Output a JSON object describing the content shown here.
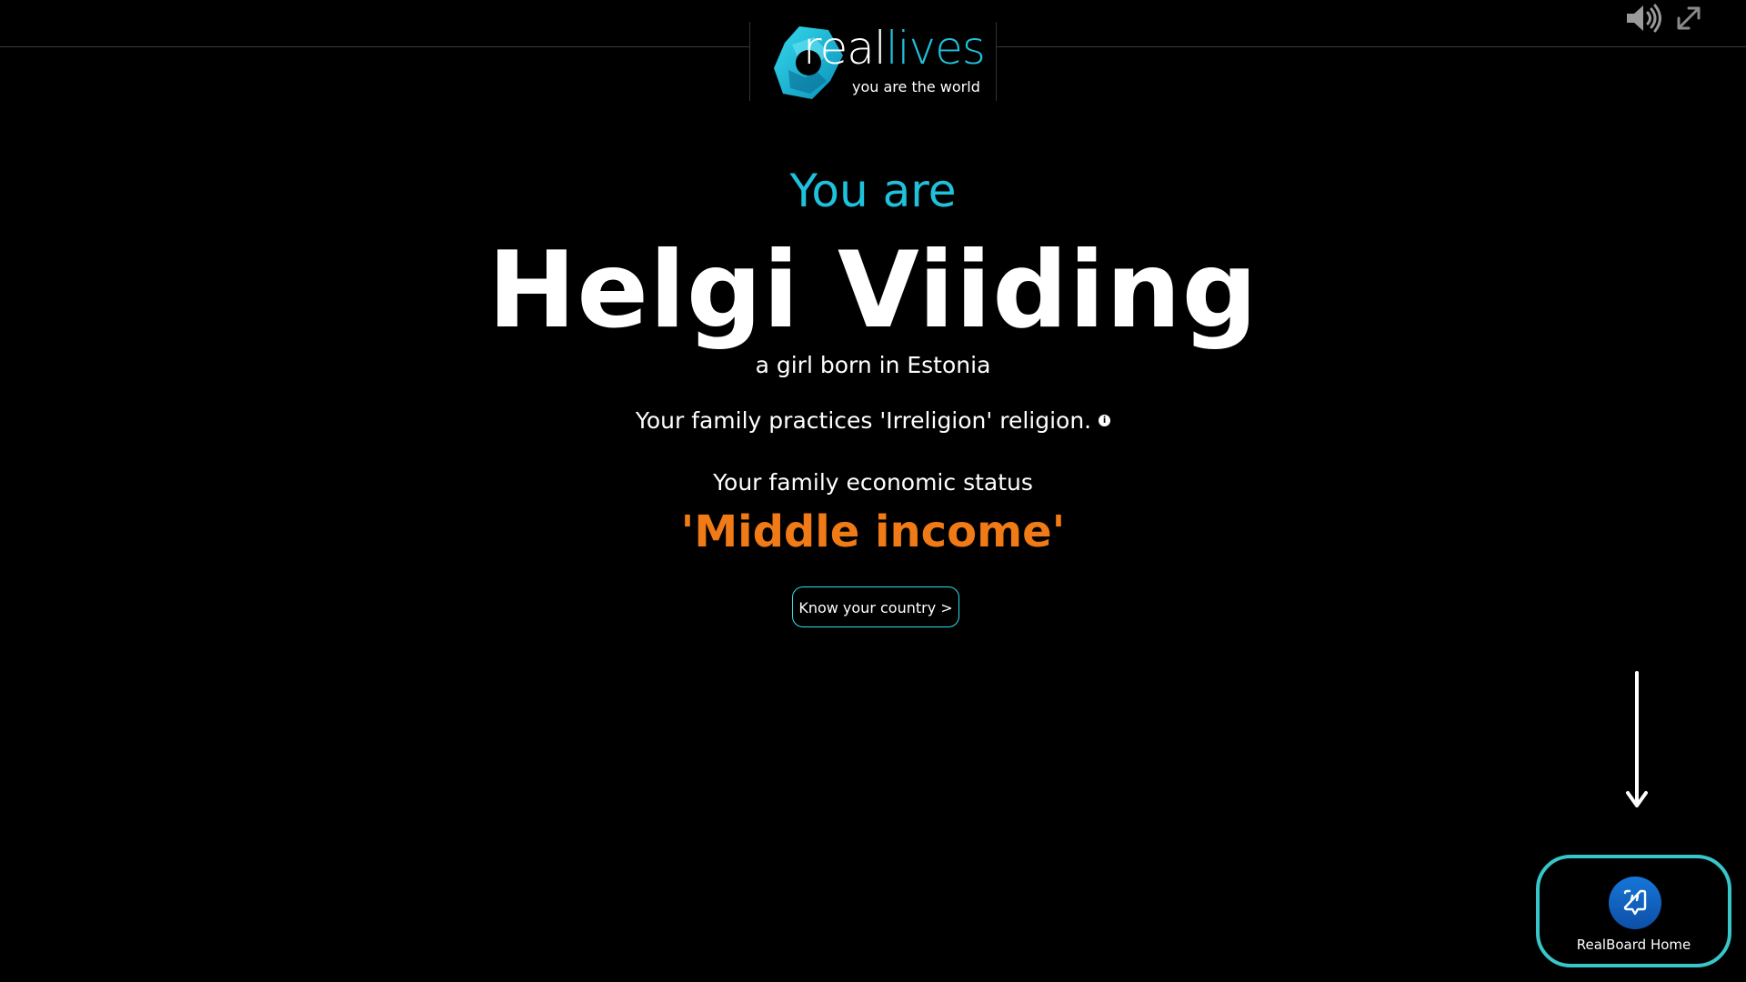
{
  "brand": {
    "word_part1": "real",
    "word_part2": "lives",
    "tagline": "you are the world",
    "accent_color": "#1fc2dc"
  },
  "toolbar": {
    "sound_icon": "speaker-volume-icon",
    "fullscreen_icon": "expand-arrows-icon"
  },
  "profile": {
    "intro": "You are",
    "name": "Helgi Viiding",
    "birth_text": "a girl born in Estonia",
    "religion_text": "Your family practices 'Irreligion' religion.",
    "info_glyph": "i",
    "economic_label": "Your family economic status",
    "economic_value": "'Middle income'",
    "economic_color": "#f07a16"
  },
  "actions": {
    "know_country_label": "Know your country >",
    "realboard_label": "RealBoard Home",
    "realboard_icon": "chat-quote-icon"
  }
}
